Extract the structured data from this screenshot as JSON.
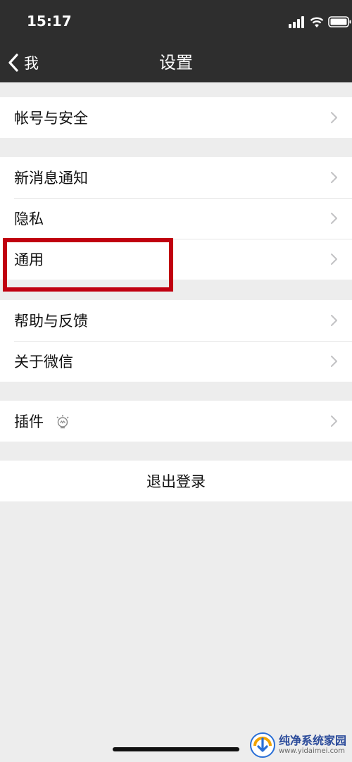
{
  "status_bar": {
    "time": "15:17"
  },
  "nav": {
    "back_label": "我",
    "title": "设置"
  },
  "groups": [
    {
      "items": [
        {
          "label": "帐号与安全"
        }
      ]
    },
    {
      "items": [
        {
          "label": "新消息通知"
        },
        {
          "label": "隐私"
        },
        {
          "label": "通用"
        }
      ]
    },
    {
      "items": [
        {
          "label": "帮助与反馈"
        },
        {
          "label": "关于微信"
        }
      ]
    },
    {
      "items": [
        {
          "label": "插件",
          "icon": "bulb-icon"
        }
      ]
    }
  ],
  "logout": {
    "label": "退出登录"
  },
  "highlight": {
    "target": "通用",
    "color": "#c00010"
  },
  "watermark": {
    "title": "纯净系统家园",
    "url": "www.yidaimei.com"
  }
}
